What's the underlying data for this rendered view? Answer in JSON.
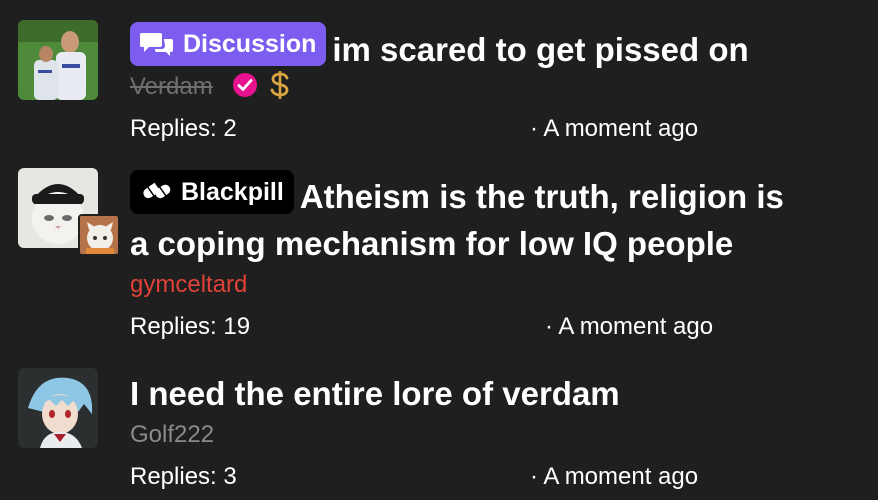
{
  "threads": [
    {
      "tag": {
        "label": "Discussion",
        "icon": "chat-bubbles-icon",
        "color": "#7d5cf0"
      },
      "title": "im scared to get pissed on",
      "author": "Verdam",
      "author_style": "strikethrough",
      "author_badges": [
        "verified-check-icon",
        "dollar-sign-icon"
      ],
      "replies_label": "Replies: 2",
      "time": "· A moment ago"
    },
    {
      "tag": {
        "label": "Blackpill",
        "icon": "pill-capsule-icon",
        "color": "#000000"
      },
      "title_line1": "Atheism is the truth, religion is",
      "title_line2": "a coping mechanism for low IQ people",
      "author": "gymceltard",
      "author_color": "#e0423a",
      "replies_label": "Replies: 19",
      "time": "· A moment ago"
    },
    {
      "title": "I need the entire lore of verdam",
      "author": "Golf222",
      "author_color": "#8a8a8a",
      "replies_label": "Replies: 3",
      "time": "· A moment ago"
    }
  ],
  "colors": {
    "background": "#1f1f1f",
    "verified_badge": "#e6128f",
    "dollar_badge": "#d9a441"
  }
}
